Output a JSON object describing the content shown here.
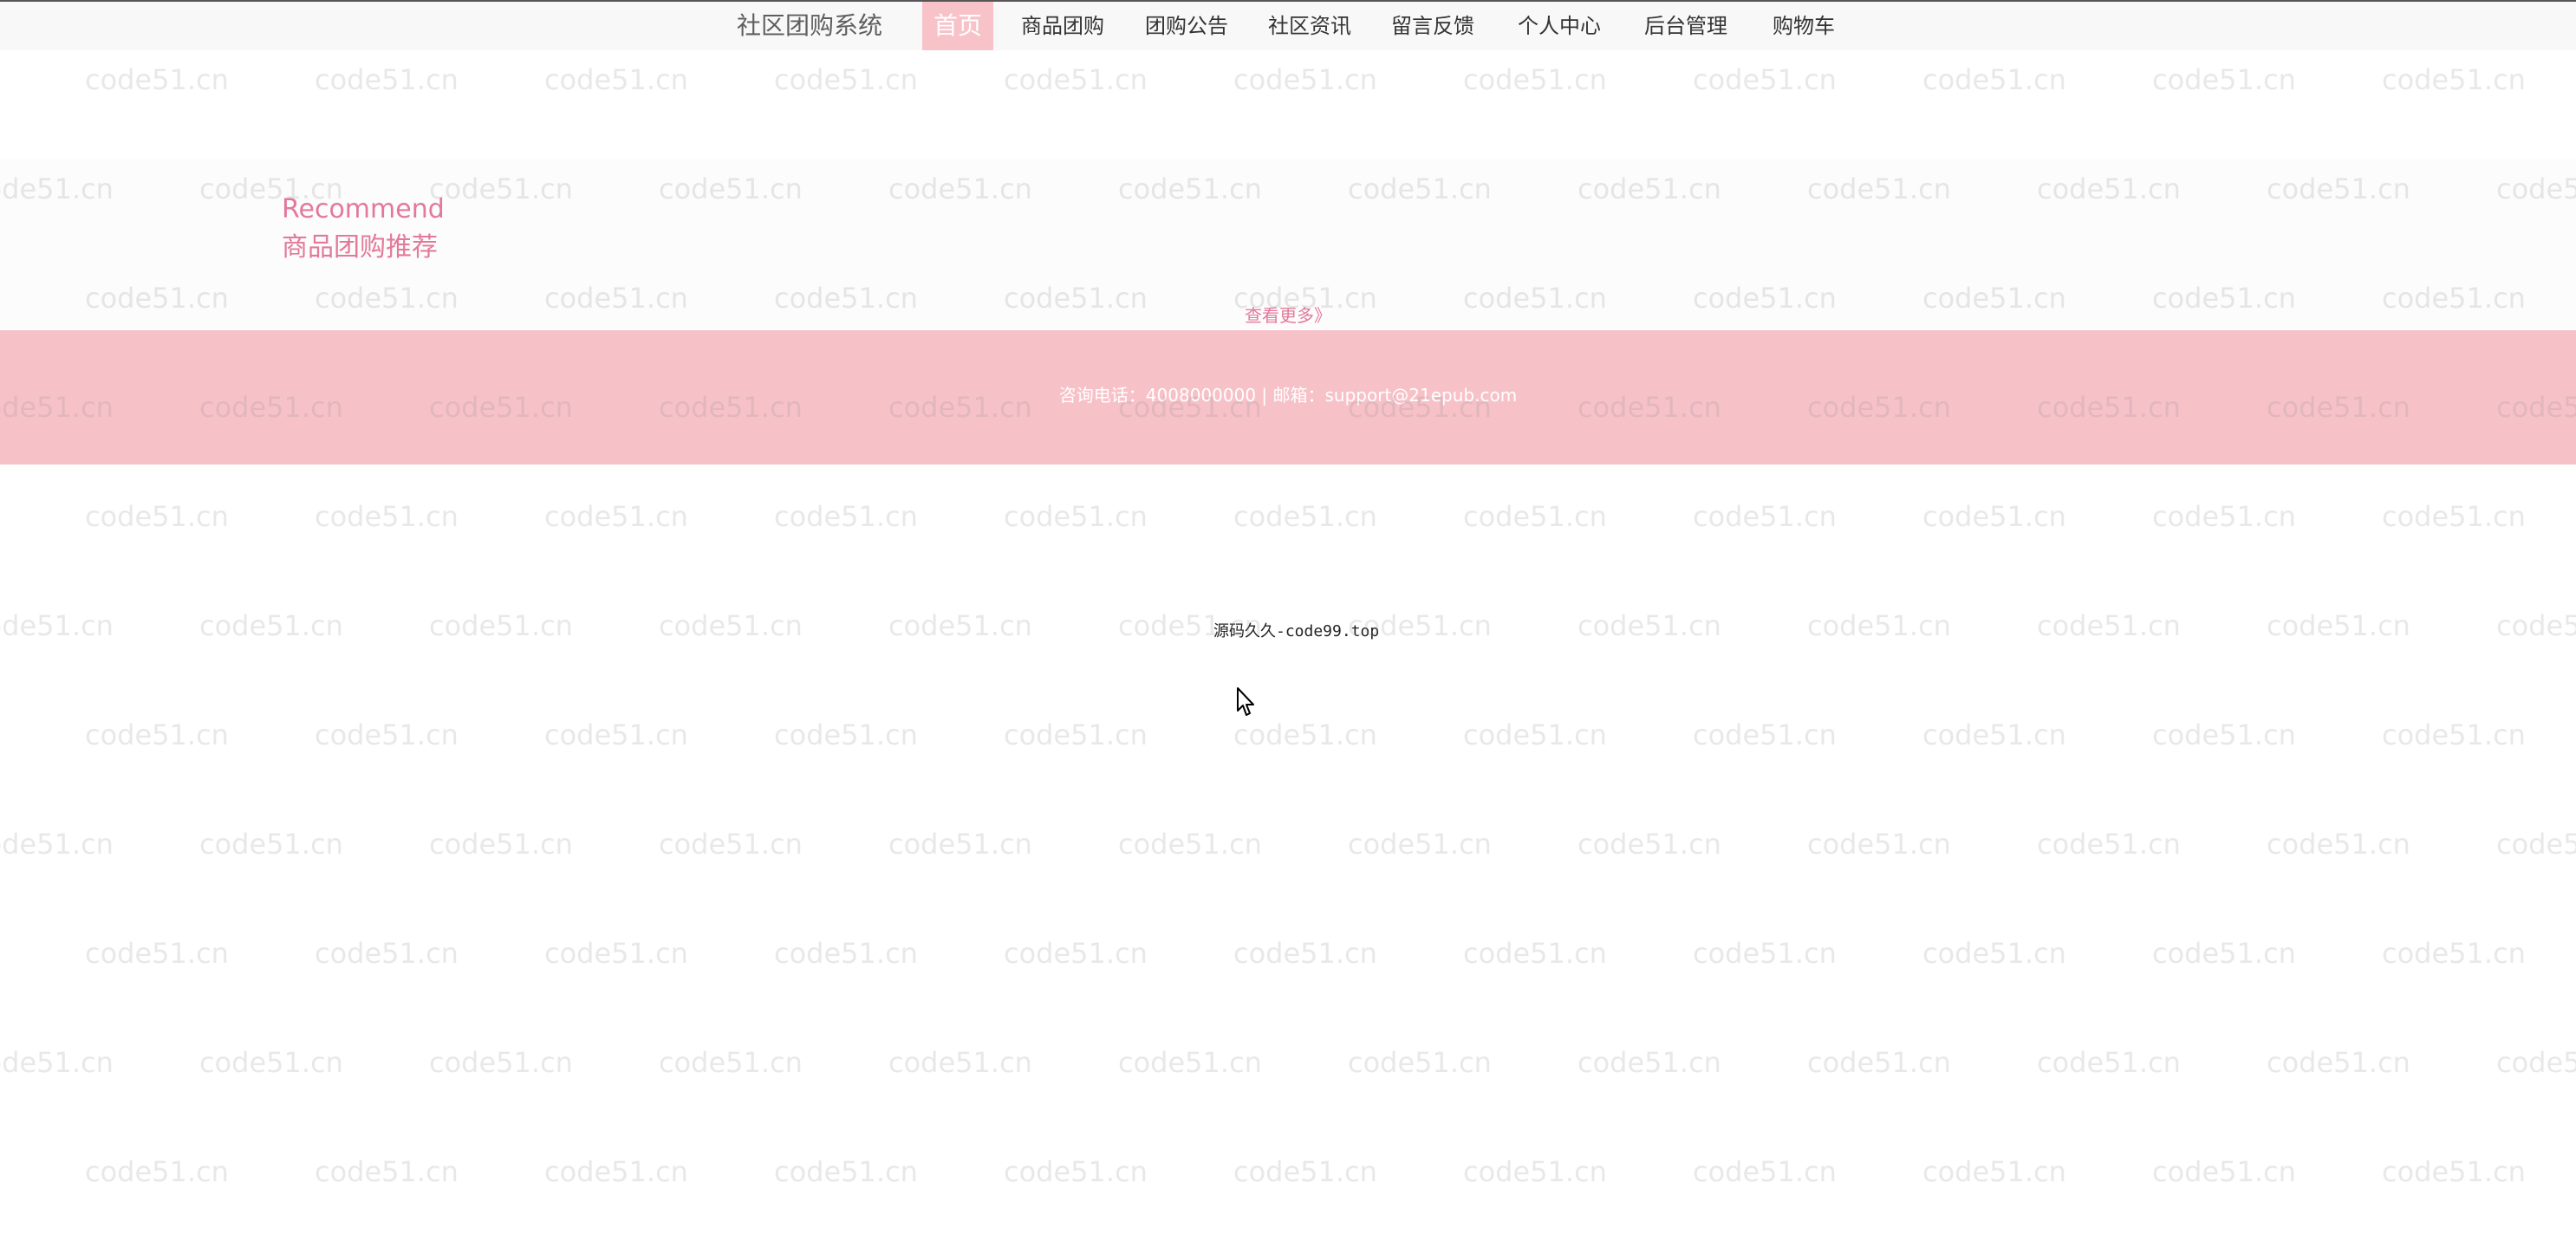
{
  "navbar": {
    "brand": "社区团购系统",
    "items": [
      {
        "label": "首页",
        "active": true
      },
      {
        "label": "商品团购"
      },
      {
        "label": "团购公告"
      },
      {
        "label": "社区资讯"
      },
      {
        "label": "留言反馈"
      },
      {
        "label": "个人中心"
      },
      {
        "label": "后台管理"
      },
      {
        "label": "购物车"
      }
    ]
  },
  "recommend": {
    "title_en": "Recommend",
    "title_cn": "商品团购推荐",
    "more_link": "查看更多》"
  },
  "footer": {
    "contact": "咨询电话：4008000000 | 邮箱：support@21epub.com"
  },
  "source_text": "源码久久-code99.top",
  "watermark": "code51.cn",
  "icons": {
    "cursor": "mouse-pointer-icon"
  },
  "colors": {
    "accent": "#e3799a",
    "footer_bg": "#f7c1c8",
    "nav_active_bg": "#f7c3c9",
    "navbar_bg": "#f8f8f8"
  }
}
